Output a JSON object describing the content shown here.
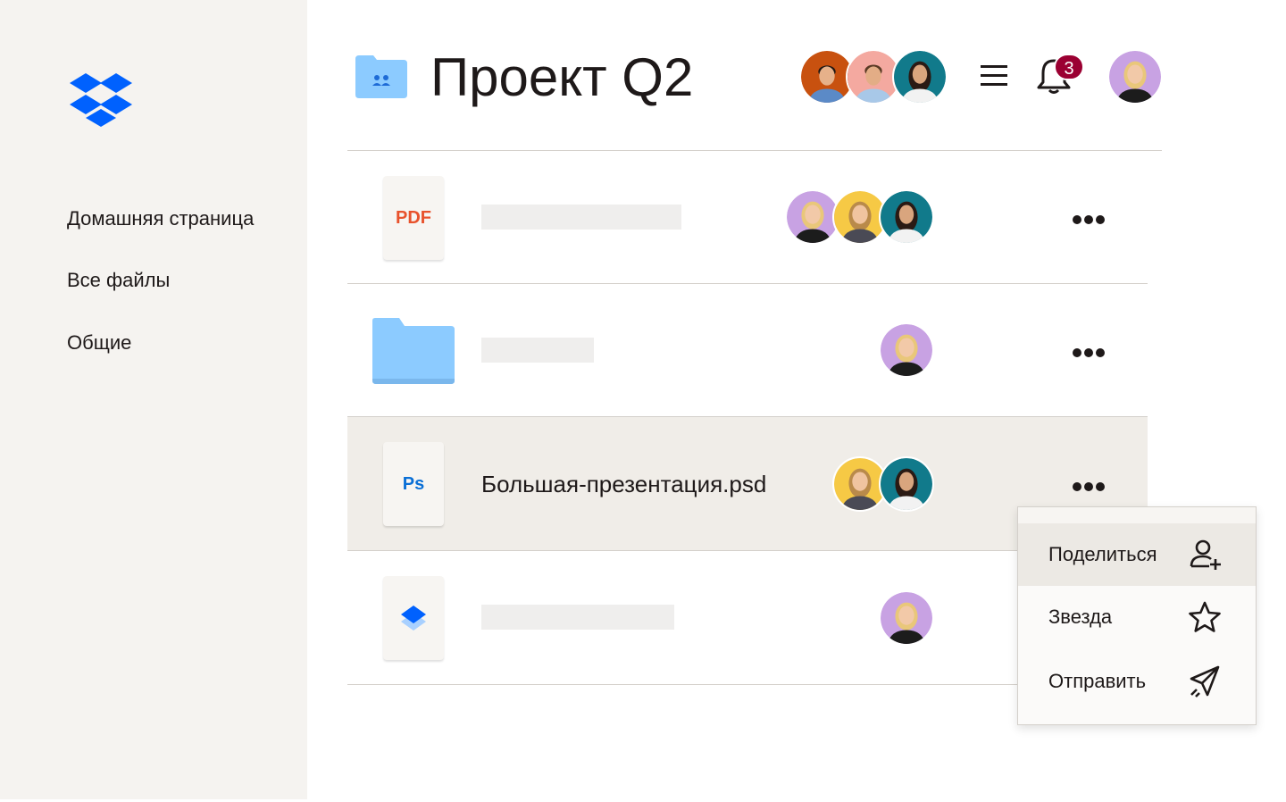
{
  "sidebar": {
    "logo_icon": "dropbox-logo",
    "items": [
      {
        "label": "Домашняя страница"
      },
      {
        "label": "Все файлы"
      },
      {
        "label": "Общие"
      }
    ]
  },
  "header": {
    "folder_icon": "shared-folder-icon",
    "title": "Проект Q2",
    "notification_count": "3",
    "menu_icon": "hamburger-menu-icon",
    "bell_icon": "bell-icon"
  },
  "files": [
    {
      "icon": "pdf-file-icon",
      "type_label": "PDF",
      "name": "",
      "more_icon": "more-options-icon"
    },
    {
      "icon": "folder-icon",
      "type_label": "",
      "name": "",
      "more_icon": "more-options-icon"
    },
    {
      "icon": "photoshop-file-icon",
      "type_label": "Ps",
      "name": "Большая-презентация.psd",
      "more_icon": "more-options-icon"
    },
    {
      "icon": "dropbox-file-icon",
      "type_label": "",
      "name": "",
      "more_icon": "more-options-icon"
    }
  ],
  "context_menu": {
    "items": [
      {
        "label": "Поделиться",
        "icon": "add-user-icon"
      },
      {
        "label": "Звезда",
        "icon": "star-icon"
      },
      {
        "label": "Отправить",
        "icon": "send-icon"
      }
    ]
  },
  "colors": {
    "brand_blue": "#0061fe",
    "folder_blue": "#8ccbff",
    "badge_red": "#9b0032",
    "pdf_red": "#e8522c",
    "ps_blue": "#0a6fd6",
    "sidebar_bg": "#f5f3f0",
    "selected_row_bg": "#f0ede8"
  }
}
